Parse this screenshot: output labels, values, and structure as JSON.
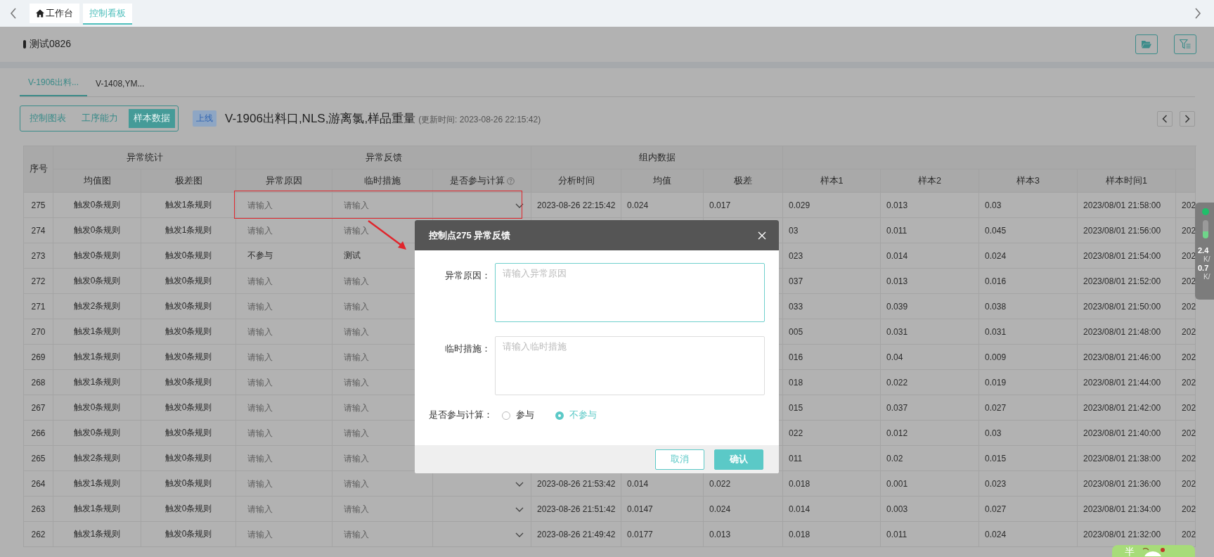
{
  "top_tabs": [
    {
      "label": "工作台",
      "selected": false
    },
    {
      "label": "控制看板",
      "selected": true
    }
  ],
  "page_title": "测试0826",
  "chart_tabs": [
    {
      "label": "V-1906出料...",
      "selected": true
    },
    {
      "label": "V-1408,YM...",
      "selected": false
    }
  ],
  "view_switch": [
    {
      "label": "控制图表",
      "selected": false
    },
    {
      "label": "工序能力",
      "selected": false
    },
    {
      "label": "样本数据",
      "selected": true
    }
  ],
  "status_tag": "上线",
  "chart_title": "V-1906出料口,NLS,游离氯,样品重量",
  "updated": "(更新时间: 2023-08-26 22:15:42)",
  "table": {
    "index_header": "序号",
    "group_headers": [
      {
        "label": "异常统计"
      },
      {
        "label": "异常反馈"
      },
      {
        "label": "组内数据"
      }
    ],
    "columns": [
      {
        "label": "均值图"
      },
      {
        "label": "极差图"
      },
      {
        "label": "异常原因"
      },
      {
        "label": "临时措施"
      },
      {
        "label": "是否参与计算",
        "help": true
      },
      {
        "label": "分析时间"
      },
      {
        "label": "均值"
      },
      {
        "label": "极差"
      },
      {
        "label": "样本1"
      },
      {
        "label": "样本2"
      },
      {
        "label": "样本3"
      },
      {
        "label": "样本时间1"
      }
    ],
    "rows": [
      {
        "no": "275",
        "mean_chart": "触发0条规则",
        "range_chart": "触发1条规则",
        "reason": {
          "placeholder": "请输入"
        },
        "measure": {
          "placeholder": "请输入"
        },
        "dropdown": true,
        "analysis_time": "2023-08-26 22:15:42",
        "mean": "0.024",
        "range": "0.017",
        "sample1": "0.029",
        "sample2": "0.013",
        "sample3": "0.03",
        "sample_time1": "2023/08/01 21:58:00",
        "column_14": "202"
      },
      {
        "no": "274",
        "mean_chart": "触发0条规则",
        "range_chart": "触发1条规则",
        "reason": {
          "placeholder": "请输入"
        },
        "measure": {
          "placeholder": "请输入"
        },
        "sample1": "03",
        "sample2": "0.011",
        "sample3": "0.045",
        "sample_time1": "2023/08/01 21:56:00",
        "column_14": "202"
      },
      {
        "no": "273",
        "mean_chart": "触发0条规则",
        "range_chart": "触发0条规则",
        "reason": {
          "value": "不参与"
        },
        "measure": {
          "value": "测试"
        },
        "sample1": "023",
        "sample2": "0.014",
        "sample3": "0.024",
        "sample_time1": "2023/08/01 21:54:00",
        "column_14": "202"
      },
      {
        "no": "272",
        "mean_chart": "触发0条规则",
        "range_chart": "触发0条规则",
        "reason": {
          "placeholder": "请输入"
        },
        "measure": {
          "placeholder": "请输入"
        },
        "sample1": "037",
        "sample2": "0.013",
        "sample3": "0.016",
        "sample_time1": "2023/08/01 21:52:00",
        "column_14": "202"
      },
      {
        "no": "271",
        "mean_chart": "触发2条规则",
        "range_chart": "触发0条规则",
        "reason": {
          "placeholder": "请输入"
        },
        "measure": {
          "placeholder": "请输入"
        },
        "sample1": "033",
        "sample2": "0.039",
        "sample3": "0.038",
        "sample_time1": "2023/08/01 21:50:00",
        "column_14": "202"
      },
      {
        "no": "270",
        "mean_chart": "触发1条规则",
        "range_chart": "触发0条规则",
        "reason": {
          "placeholder": "请输入"
        },
        "measure": {
          "placeholder": "请输入"
        },
        "sample1": "005",
        "sample2": "0.031",
        "sample3": "0.031",
        "sample_time1": "2023/08/01 21:48:00",
        "column_14": "202"
      },
      {
        "no": "269",
        "mean_chart": "触发1条规则",
        "range_chart": "触发0条规则",
        "reason": {
          "placeholder": "请输入"
        },
        "measure": {
          "placeholder": "请输入"
        },
        "sample1": "016",
        "sample2": "0.04",
        "sample3": "0.009",
        "sample_time1": "2023/08/01 21:46:00",
        "column_14": "202"
      },
      {
        "no": "268",
        "mean_chart": "触发1条规则",
        "range_chart": "触发0条规则",
        "reason": {
          "placeholder": "请输入"
        },
        "measure": {
          "placeholder": "请输入"
        },
        "sample1": "018",
        "sample2": "0.022",
        "sample3": "0.019",
        "sample_time1": "2023/08/01 21:44:00",
        "column_14": "202"
      },
      {
        "no": "267",
        "mean_chart": "触发0条规则",
        "range_chart": "触发0条规则",
        "reason": {
          "placeholder": "请输入"
        },
        "measure": {
          "placeholder": "请输入"
        },
        "sample1": "015",
        "sample2": "0.037",
        "sample3": "0.027",
        "sample_time1": "2023/08/01 21:42:00",
        "column_14": "202"
      },
      {
        "no": "266",
        "mean_chart": "触发0条规则",
        "range_chart": "触发0条规则",
        "reason": {
          "placeholder": "请输入"
        },
        "measure": {
          "placeholder": "请输入"
        },
        "sample1": "022",
        "sample2": "0.012",
        "sample3": "0.03",
        "sample_time1": "2023/08/01 21:40:00",
        "column_14": "202"
      },
      {
        "no": "265",
        "mean_chart": "触发2条规则",
        "range_chart": "触发0条规则",
        "reason": {
          "placeholder": "请输入"
        },
        "measure": {
          "placeholder": "请输入"
        },
        "sample1": "011",
        "sample2": "0.02",
        "sample3": "0.015",
        "sample_time1": "2023/08/01 21:38:00",
        "column_14": "202"
      },
      {
        "no": "264",
        "mean_chart": "触发1条规则",
        "range_chart": "触发0条规则",
        "reason": {
          "placeholder": "请输入"
        },
        "measure": {
          "placeholder": "请输入"
        },
        "dropdown": true,
        "analysis_time": "2023-08-26 21:53:42",
        "mean": "0.014",
        "range": "0.022",
        "sample1": "0.018",
        "sample2": "0.001",
        "sample3": "0.023",
        "sample_time1": "2023/08/01 21:36:00",
        "column_14": "202"
      },
      {
        "no": "263",
        "mean_chart": "触发1条规则",
        "range_chart": "触发0条规则",
        "reason": {
          "placeholder": "请输入"
        },
        "measure": {
          "placeholder": "请输入"
        },
        "dropdown": true,
        "analysis_time": "2023-08-26 21:51:42",
        "mean": "0.0147",
        "range": "0.024",
        "sample1": "0.014",
        "sample2": "0.003",
        "sample3": "0.027",
        "sample_time1": "2023/08/01 21:34:00",
        "column_14": "202"
      },
      {
        "no": "262",
        "mean_chart": "触发1条规则",
        "range_chart": "触发0条规则",
        "reason": {
          "placeholder": "请输入"
        },
        "measure": {
          "placeholder": "请输入"
        },
        "dropdown": true,
        "analysis_time": "2023-08-26 21:49:42",
        "mean": "0.0177",
        "range": "0.013",
        "sample1": "0.018",
        "sample2": "0.011",
        "sample3": "0.024",
        "sample_time1": "2023/08/01 21:32:00",
        "column_14": "202"
      }
    ]
  },
  "modal": {
    "title": "控制点275 异常反馈",
    "fields": [
      {
        "label": "异常原因：",
        "placeholder": "请输入异常原因",
        "focused": true
      },
      {
        "label": "临时措施：",
        "placeholder": "请输入临时措施",
        "focused": false
      }
    ],
    "participate": {
      "label": "是否参与计算：",
      "options": [
        {
          "label": "参与",
          "selected": false
        },
        {
          "label": "不参与",
          "selected": true
        }
      ]
    },
    "buttons": [
      {
        "label": "取消",
        "kind": "secondary"
      },
      {
        "label": "确认",
        "kind": "primary"
      }
    ]
  },
  "network_widget": {
    "upload": "2.4",
    "upload_unit": "K/",
    "download": "0.7",
    "download_unit": "K/"
  },
  "mascot": {
    "text": "半"
  }
}
